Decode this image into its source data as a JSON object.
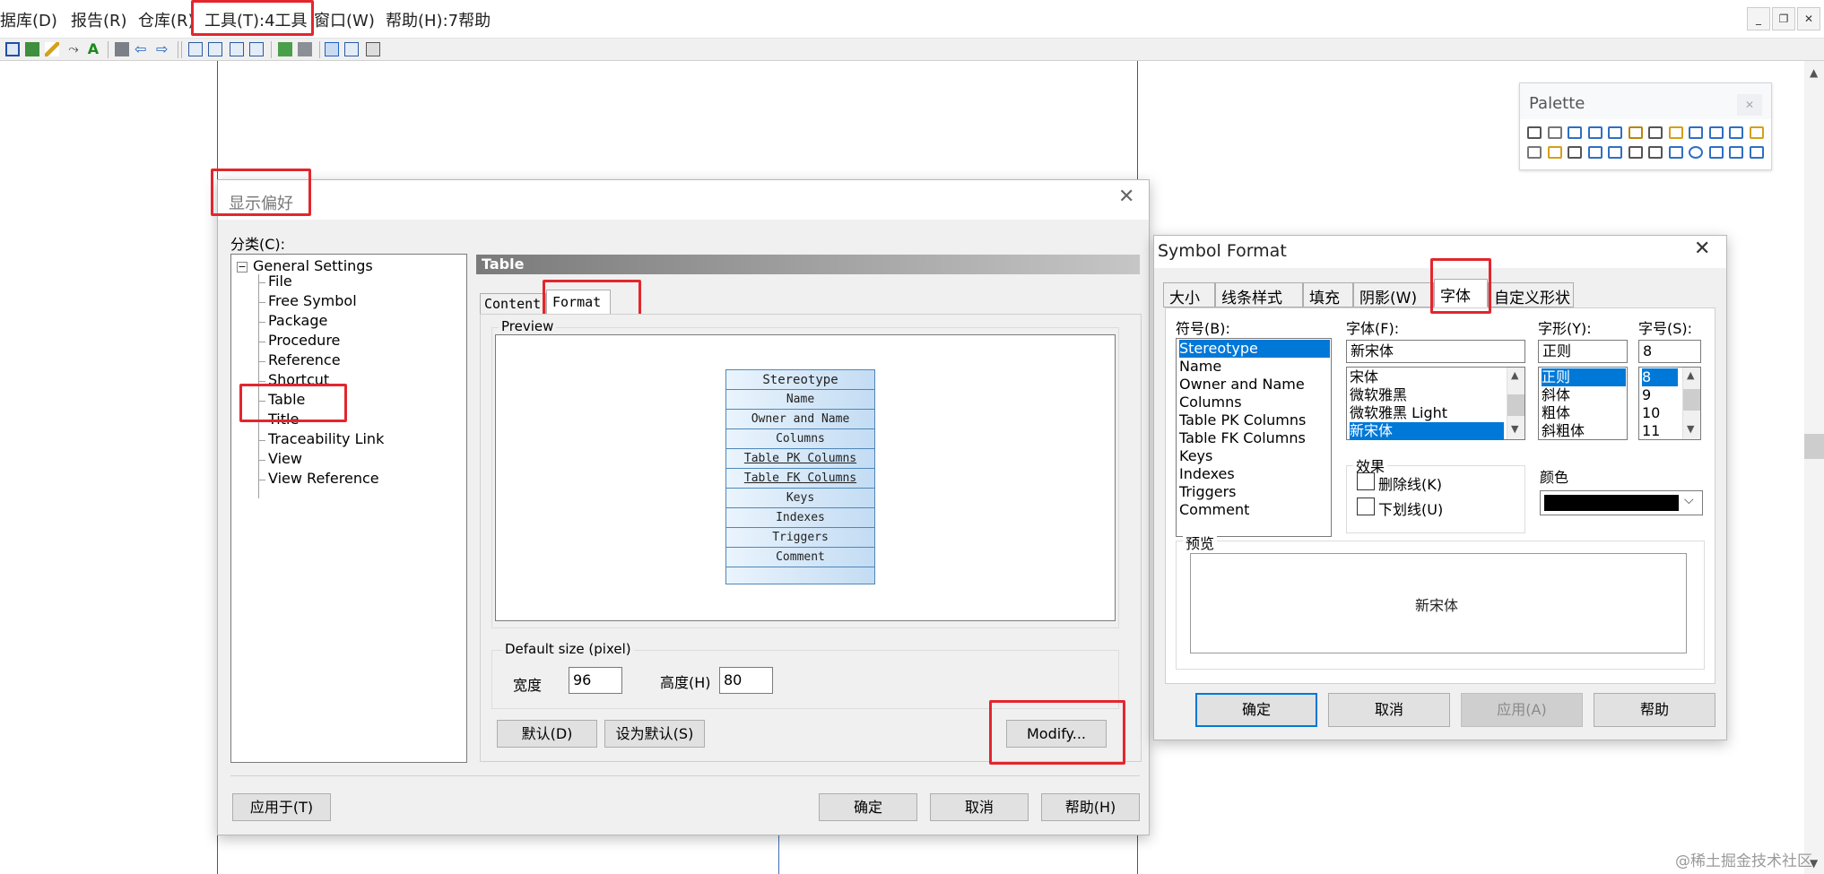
{
  "menubar": {
    "items": [
      "据库(D)",
      "报告(R)",
      "仓库(R)",
      "工具(T):4工具",
      "窗口(W)",
      "帮助(H):7帮助"
    ]
  },
  "display_prefs": {
    "title": "显示偏好",
    "category_label": "分类(C):",
    "tree": {
      "root": "General Settings",
      "children": [
        "File",
        "Free Symbol",
        "Package",
        "Procedure",
        "Reference",
        "Shortcut",
        "Table",
        "Title",
        "Traceability Link",
        "View",
        "View Reference"
      ]
    },
    "panel_header": "Table",
    "tabs": [
      "Content",
      "Format"
    ],
    "preview_label": "Preview",
    "preview_rows": [
      "Stereotype",
      "Name",
      "Owner and Name",
      "Columns",
      "Table PK Columns",
      "Table FK Columns",
      "Keys",
      "Indexes",
      "Triggers",
      "Comment"
    ],
    "default_size_label": "Default size (pixel)",
    "width_label": "宽度",
    "width_value": "96",
    "height_label": "高度(H)",
    "height_value": "80",
    "buttons": {
      "default": "默认(D)",
      "set_default": "设为默认(S)",
      "modify": "Modify...",
      "apply_to": "应用于(T)",
      "ok": "确定",
      "cancel": "取消",
      "help": "帮助(H)"
    }
  },
  "palette": {
    "title": "Palette"
  },
  "symbol_format": {
    "title": "Symbol Format",
    "tabs": [
      "大小",
      "线条样式",
      "填充",
      "阴影(W)",
      "字体",
      "自定义形状"
    ],
    "symbol_label": "符号(B):",
    "symbol_items": [
      "Stereotype",
      "Name",
      "Owner and Name",
      "Columns",
      "Table PK Columns",
      "Table FK Columns",
      "Keys",
      "Indexes",
      "Triggers",
      "Comment"
    ],
    "font_label": "字体(F):",
    "font_value": "新宋体",
    "font_items": [
      "宋体",
      "微软雅黑",
      "微软雅黑 Light",
      "新宋体"
    ],
    "style_label": "字形(Y):",
    "style_value": "正则",
    "style_items": [
      "正则",
      "斜体",
      "粗体",
      "斜粗体"
    ],
    "size_label": "字号(S):",
    "size_value": "8",
    "size_items": [
      "8",
      "9",
      "10",
      "11"
    ],
    "effects_label": "效果",
    "strikeout_label": "删除线(K)",
    "underline_label": "下划线(U)",
    "color_label": "颜色",
    "preview_label": "预览",
    "preview_text": "新宋体",
    "buttons": {
      "ok": "确定",
      "cancel": "取消",
      "apply": "应用(A)",
      "help": "帮助"
    }
  },
  "watermark": "@稀土掘金技术社区",
  "colors": {
    "highlight": "#e3262d",
    "selection": "#0078d7"
  }
}
